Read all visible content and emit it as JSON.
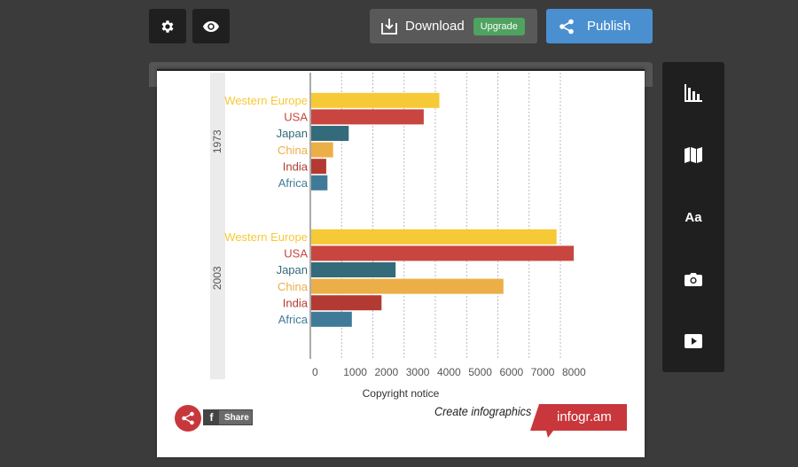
{
  "toolbar": {
    "settings_icon": "gear-icon",
    "preview_icon": "eye-icon",
    "download_label": "Download",
    "upgrade_label": "Upgrade",
    "publish_label": "Publish"
  },
  "sidebar": {
    "items": [
      {
        "icon": "bar-chart-icon"
      },
      {
        "icon": "map-icon"
      },
      {
        "icon": "text-icon",
        "label": "Aa"
      },
      {
        "icon": "camera-icon"
      },
      {
        "icon": "video-icon"
      }
    ]
  },
  "chart_data": {
    "type": "bar",
    "orientation": "horizontal",
    "groups": [
      {
        "name": "1973",
        "categories": [
          "Western Europe",
          "USA",
          "Japan",
          "China",
          "India",
          "Africa"
        ],
        "values": [
          4100,
          3600,
          1200,
          700,
          480,
          520
        ]
      },
      {
        "name": "2003",
        "categories": [
          "Western Europe",
          "USA",
          "Japan",
          "China",
          "India",
          "Africa"
        ],
        "values": [
          7850,
          8400,
          2700,
          6150,
          2250,
          1300
        ]
      }
    ],
    "category_colors": [
      "#f6c936",
      "#c8463f",
      "#336b7a",
      "#ecaf48",
      "#b33a32",
      "#3f7b98"
    ],
    "xlim": [
      0,
      8000
    ],
    "xticks": [
      0,
      1000,
      2000,
      3000,
      4000,
      5000,
      6000,
      7000,
      8000
    ],
    "xlabel": "Copyright notice",
    "grid": true
  },
  "footer": {
    "share_label": "Share",
    "fb_letter": "f",
    "create_text": "Create infographics",
    "brand": "infogr.am",
    "brand_color": "#c8373b"
  }
}
